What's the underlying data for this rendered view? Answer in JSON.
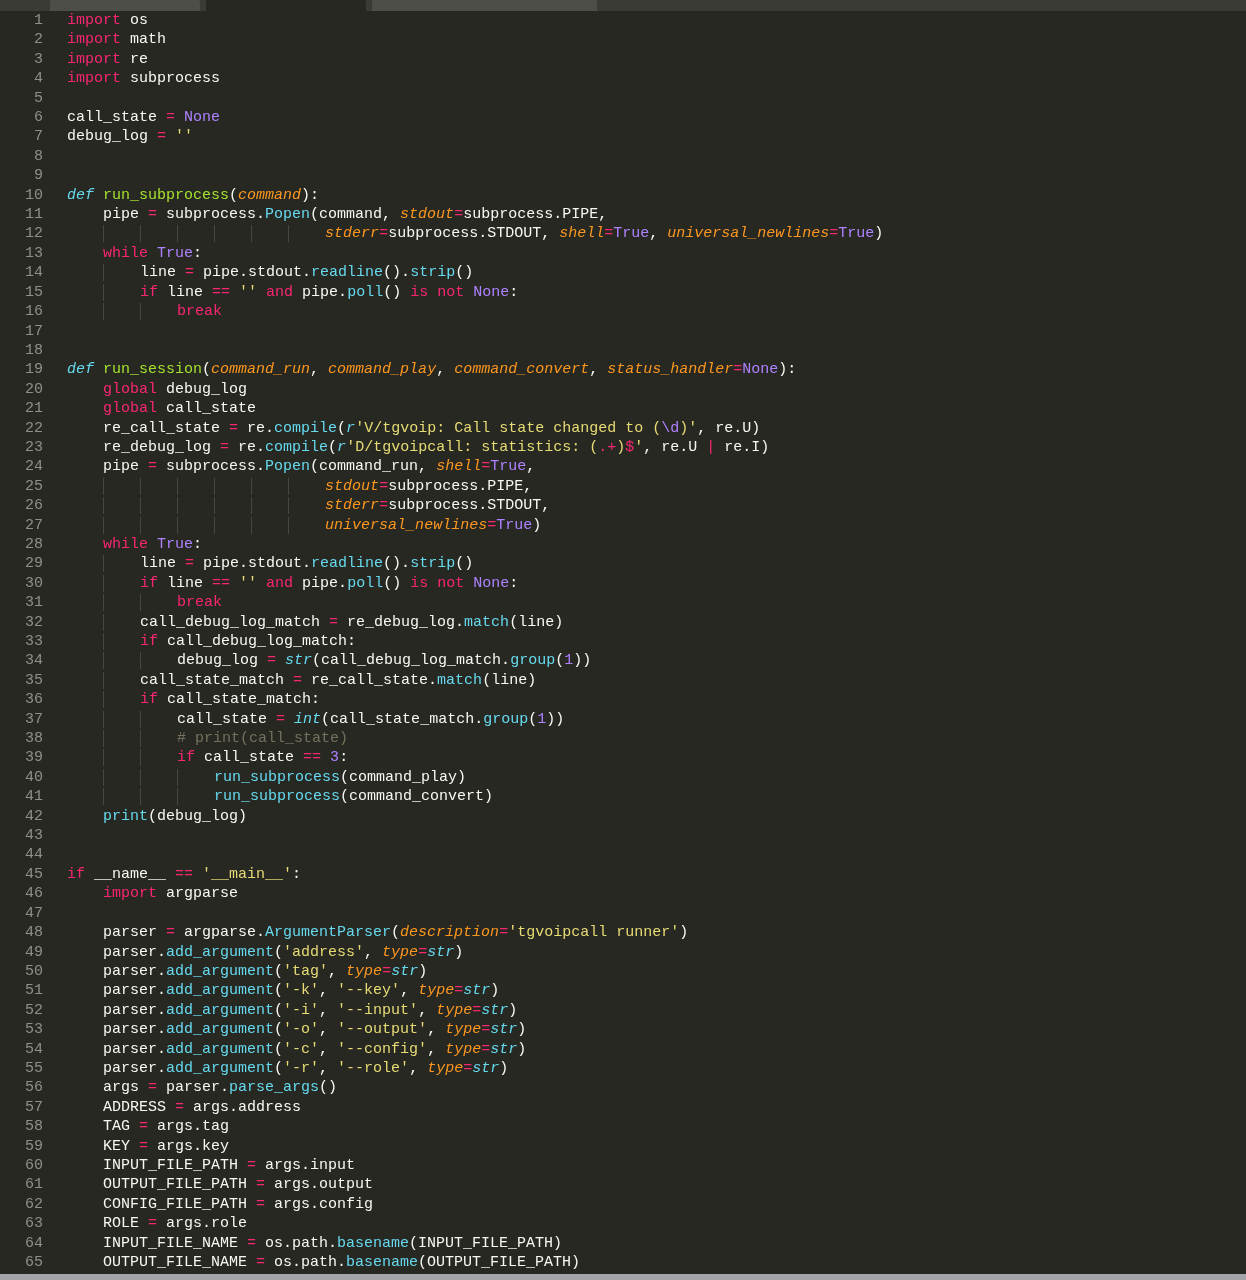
{
  "tabs": [
    {
      "selected": false
    },
    {
      "selected": true
    },
    {
      "selected": false
    }
  ],
  "lines": [
    {
      "number": "1",
      "tokens": [
        {
          "kind": "k",
          "text": "import"
        },
        {
          "kind": "p",
          "text": " os"
        }
      ]
    },
    {
      "number": "2",
      "tokens": [
        {
          "kind": "k",
          "text": "import"
        },
        {
          "kind": "p",
          "text": " math"
        }
      ]
    },
    {
      "number": "3",
      "tokens": [
        {
          "kind": "k",
          "text": "import"
        },
        {
          "kind": "p",
          "text": " re"
        }
      ]
    },
    {
      "number": "4",
      "tokens": [
        {
          "kind": "k",
          "text": "import"
        },
        {
          "kind": "p",
          "text": " subprocess"
        }
      ]
    },
    {
      "number": "5"
    },
    {
      "number": "6",
      "tokens": [
        {
          "kind": "p",
          "text": "call_state "
        },
        {
          "kind": "k",
          "text": "="
        },
        {
          "kind": "c",
          "text": " None"
        }
      ]
    },
    {
      "number": "7",
      "tokens": [
        {
          "kind": "p",
          "text": "debug_log "
        },
        {
          "kind": "k",
          "text": "="
        },
        {
          "kind": "s",
          "text": " ''"
        }
      ]
    },
    {
      "number": "8"
    },
    {
      "number": "9"
    },
    {
      "number": "10",
      "tokens": [
        {
          "kind": "d",
          "text": "def"
        },
        {
          "kind": "f",
          "text": " run_subprocess"
        },
        {
          "kind": "p",
          "text": "("
        },
        {
          "kind": "a",
          "text": "command"
        },
        {
          "kind": "p",
          "text": "):"
        }
      ]
    },
    {
      "number": "11",
      "tokens": [
        {
          "kind": "p",
          "text": "    pipe "
        },
        {
          "kind": "k",
          "text": "="
        },
        {
          "kind": "p",
          "text": " subprocess."
        },
        {
          "kind": "m",
          "text": "Popen"
        },
        {
          "kind": "p",
          "text": "(command, "
        },
        {
          "kind": "a",
          "text": "stdout"
        },
        {
          "kind": "k",
          "text": "="
        },
        {
          "kind": "p",
          "text": "subprocess.PIPE,"
        }
      ]
    },
    {
      "number": "12",
      "tokens": [
        {
          "kind": "a",
          "text": "                            stderr"
        },
        {
          "kind": "k",
          "text": "="
        },
        {
          "kind": "p",
          "text": "subprocess.STDOUT, "
        },
        {
          "kind": "a",
          "text": "shell"
        },
        {
          "kind": "k",
          "text": "="
        },
        {
          "kind": "c",
          "text": "True"
        },
        {
          "kind": "p",
          "text": ", "
        },
        {
          "kind": "a",
          "text": "universal_newlines"
        },
        {
          "kind": "k",
          "text": "="
        },
        {
          "kind": "c",
          "text": "True"
        },
        {
          "kind": "p",
          "text": ")"
        }
      ]
    },
    {
      "number": "13",
      "tokens": [
        {
          "kind": "k",
          "text": "    while"
        },
        {
          "kind": "c",
          "text": " True"
        },
        {
          "kind": "p",
          "text": ":"
        }
      ]
    },
    {
      "number": "14",
      "tokens": [
        {
          "kind": "p",
          "text": "        line "
        },
        {
          "kind": "k",
          "text": "="
        },
        {
          "kind": "p",
          "text": " pipe.stdout."
        },
        {
          "kind": "m",
          "text": "readline"
        },
        {
          "kind": "p",
          "text": "()."
        },
        {
          "kind": "m",
          "text": "strip"
        },
        {
          "kind": "p",
          "text": "()"
        }
      ]
    },
    {
      "number": "15",
      "tokens": [
        {
          "kind": "k",
          "text": "        if"
        },
        {
          "kind": "p",
          "text": " line "
        },
        {
          "kind": "k",
          "text": "=="
        },
        {
          "kind": "s",
          "text": " ''"
        },
        {
          "kind": "k",
          "text": " and"
        },
        {
          "kind": "p",
          "text": " pipe."
        },
        {
          "kind": "m",
          "text": "poll"
        },
        {
          "kind": "p",
          "text": "() "
        },
        {
          "kind": "k",
          "text": "is"
        },
        {
          "kind": "k",
          "text": " not"
        },
        {
          "kind": "c",
          "text": " None"
        },
        {
          "kind": "p",
          "text": ":"
        }
      ]
    },
    {
      "number": "16",
      "tokens": [
        {
          "kind": "k",
          "text": "            break"
        }
      ]
    },
    {
      "number": "17"
    },
    {
      "number": "18"
    },
    {
      "number": "19",
      "tokens": [
        {
          "kind": "d",
          "text": "def"
        },
        {
          "kind": "f",
          "text": " run_session"
        },
        {
          "kind": "p",
          "text": "("
        },
        {
          "kind": "a",
          "text": "command_run"
        },
        {
          "kind": "p",
          "text": ", "
        },
        {
          "kind": "a",
          "text": "command_play"
        },
        {
          "kind": "p",
          "text": ", "
        },
        {
          "kind": "a",
          "text": "command_convert"
        },
        {
          "kind": "p",
          "text": ", "
        },
        {
          "kind": "a",
          "text": "status_handler"
        },
        {
          "kind": "k",
          "text": "="
        },
        {
          "kind": "c",
          "text": "None"
        },
        {
          "kind": "p",
          "text": "):"
        }
      ]
    },
    {
      "number": "20",
      "tokens": [
        {
          "kind": "k",
          "text": "    global"
        },
        {
          "kind": "p",
          "text": " debug_log"
        }
      ]
    },
    {
      "number": "21",
      "tokens": [
        {
          "kind": "k",
          "text": "    global"
        },
        {
          "kind": "p",
          "text": " call_state"
        }
      ]
    },
    {
      "number": "22",
      "tokens": [
        {
          "kind": "p",
          "text": "    re_call_state "
        },
        {
          "kind": "k",
          "text": "="
        },
        {
          "kind": "p",
          "text": " re."
        },
        {
          "kind": "m",
          "text": "compile"
        },
        {
          "kind": "p",
          "text": "("
        },
        {
          "kind": "b",
          "text": "r"
        },
        {
          "kind": "s",
          "text": "'V/tgvoip: Call state changed to ("
        },
        {
          "kind": "c",
          "text": "\\d"
        },
        {
          "kind": "s",
          "text": ")'"
        },
        {
          "kind": "p",
          "text": ", re.U)"
        }
      ]
    },
    {
      "number": "23",
      "tokens": [
        {
          "kind": "p",
          "text": "    re_debug_log "
        },
        {
          "kind": "k",
          "text": "="
        },
        {
          "kind": "p",
          "text": " re."
        },
        {
          "kind": "m",
          "text": "compile"
        },
        {
          "kind": "p",
          "text": "("
        },
        {
          "kind": "b",
          "text": "r"
        },
        {
          "kind": "s",
          "text": "'D/tgvoipcall: statistics: ("
        },
        {
          "kind": "k",
          "text": ".+"
        },
        {
          "kind": "s",
          "text": ")"
        },
        {
          "kind": "k",
          "text": "$"
        },
        {
          "kind": "s",
          "text": "'"
        },
        {
          "kind": "p",
          "text": ", re.U "
        },
        {
          "kind": "k",
          "text": "|"
        },
        {
          "kind": "p",
          "text": " re.I)"
        }
      ]
    },
    {
      "number": "24",
      "tokens": [
        {
          "kind": "p",
          "text": "    pipe "
        },
        {
          "kind": "k",
          "text": "="
        },
        {
          "kind": "p",
          "text": " subprocess."
        },
        {
          "kind": "m",
          "text": "Popen"
        },
        {
          "kind": "p",
          "text": "(command_run, "
        },
        {
          "kind": "a",
          "text": "shell"
        },
        {
          "kind": "k",
          "text": "="
        },
        {
          "kind": "c",
          "text": "True"
        },
        {
          "kind": "p",
          "text": ","
        }
      ]
    },
    {
      "number": "25",
      "tokens": [
        {
          "kind": "a",
          "text": "                            stdout"
        },
        {
          "kind": "k",
          "text": "="
        },
        {
          "kind": "p",
          "text": "subprocess.PIPE,"
        }
      ]
    },
    {
      "number": "26",
      "tokens": [
        {
          "kind": "a",
          "text": "                            stderr"
        },
        {
          "kind": "k",
          "text": "="
        },
        {
          "kind": "p",
          "text": "subprocess.STDOUT,"
        }
      ]
    },
    {
      "number": "27",
      "tokens": [
        {
          "kind": "a",
          "text": "                            universal_newlines"
        },
        {
          "kind": "k",
          "text": "="
        },
        {
          "kind": "c",
          "text": "True"
        },
        {
          "kind": "p",
          "text": ")"
        }
      ]
    },
    {
      "number": "28",
      "tokens": [
        {
          "kind": "k",
          "text": "    while"
        },
        {
          "kind": "c",
          "text": " True"
        },
        {
          "kind": "p",
          "text": ":"
        }
      ]
    },
    {
      "number": "29",
      "tokens": [
        {
          "kind": "p",
          "text": "        line "
        },
        {
          "kind": "k",
          "text": "="
        },
        {
          "kind": "p",
          "text": " pipe.stdout."
        },
        {
          "kind": "m",
          "text": "readline"
        },
        {
          "kind": "p",
          "text": "()."
        },
        {
          "kind": "m",
          "text": "strip"
        },
        {
          "kind": "p",
          "text": "()"
        }
      ]
    },
    {
      "number": "30",
      "tokens": [
        {
          "kind": "k",
          "text": "        if"
        },
        {
          "kind": "p",
          "text": " line "
        },
        {
          "kind": "k",
          "text": "=="
        },
        {
          "kind": "s",
          "text": " ''"
        },
        {
          "kind": "k",
          "text": " and"
        },
        {
          "kind": "p",
          "text": " pipe."
        },
        {
          "kind": "m",
          "text": "poll"
        },
        {
          "kind": "p",
          "text": "() "
        },
        {
          "kind": "k",
          "text": "is"
        },
        {
          "kind": "k",
          "text": " not"
        },
        {
          "kind": "c",
          "text": " None"
        },
        {
          "kind": "p",
          "text": ":"
        }
      ]
    },
    {
      "number": "31",
      "tokens": [
        {
          "kind": "k",
          "text": "            break"
        }
      ]
    },
    {
      "number": "32",
      "tokens": [
        {
          "kind": "p",
          "text": "        call_debug_log_match "
        },
        {
          "kind": "k",
          "text": "="
        },
        {
          "kind": "p",
          "text": " re_debug_log."
        },
        {
          "kind": "m",
          "text": "match"
        },
        {
          "kind": "p",
          "text": "(line)"
        }
      ]
    },
    {
      "number": "33",
      "tokens": [
        {
          "kind": "k",
          "text": "        if"
        },
        {
          "kind": "p",
          "text": " call_debug_log_match:"
        }
      ]
    },
    {
      "number": "34",
      "tokens": [
        {
          "kind": "p",
          "text": "            debug_log "
        },
        {
          "kind": "k",
          "text": "="
        },
        {
          "kind": "b",
          "text": " str"
        },
        {
          "kind": "p",
          "text": "(call_debug_log_match."
        },
        {
          "kind": "m",
          "text": "group"
        },
        {
          "kind": "p",
          "text": "("
        },
        {
          "kind": "c",
          "text": "1"
        },
        {
          "kind": "p",
          "text": "))"
        }
      ]
    },
    {
      "number": "35",
      "tokens": [
        {
          "kind": "p",
          "text": "        call_state_match "
        },
        {
          "kind": "k",
          "text": "="
        },
        {
          "kind": "p",
          "text": " re_call_state."
        },
        {
          "kind": "m",
          "text": "match"
        },
        {
          "kind": "p",
          "text": "(line)"
        }
      ]
    },
    {
      "number": "36",
      "tokens": [
        {
          "kind": "k",
          "text": "        if"
        },
        {
          "kind": "p",
          "text": " call_state_match:"
        }
      ]
    },
    {
      "number": "37",
      "tokens": [
        {
          "kind": "p",
          "text": "            call_state "
        },
        {
          "kind": "k",
          "text": "="
        },
        {
          "kind": "b",
          "text": " int"
        },
        {
          "kind": "p",
          "text": "(call_state_match."
        },
        {
          "kind": "m",
          "text": "group"
        },
        {
          "kind": "p",
          "text": "("
        },
        {
          "kind": "c",
          "text": "1"
        },
        {
          "kind": "p",
          "text": "))"
        }
      ]
    },
    {
      "number": "38",
      "tokens": [
        {
          "kind": "o",
          "text": "            # print(call_state)"
        }
      ]
    },
    {
      "number": "39",
      "tokens": [
        {
          "kind": "k",
          "text": "            if"
        },
        {
          "kind": "p",
          "text": " call_state "
        },
        {
          "kind": "k",
          "text": "=="
        },
        {
          "kind": "c",
          "text": " 3"
        },
        {
          "kind": "p",
          "text": ":"
        }
      ]
    },
    {
      "number": "40",
      "tokens": [
        {
          "kind": "m",
          "text": "                run_subprocess"
        },
        {
          "kind": "p",
          "text": "(command_play)"
        }
      ]
    },
    {
      "number": "41",
      "tokens": [
        {
          "kind": "m",
          "text": "                run_subprocess"
        },
        {
          "kind": "p",
          "text": "(command_convert)"
        }
      ]
    },
    {
      "number": "42",
      "tokens": [
        {
          "kind": "m",
          "text": "    print"
        },
        {
          "kind": "p",
          "text": "(debug_log)"
        }
      ]
    },
    {
      "number": "43"
    },
    {
      "number": "44"
    },
    {
      "number": "45",
      "tokens": [
        {
          "kind": "k",
          "text": "if"
        },
        {
          "kind": "p",
          "text": " __name__ "
        },
        {
          "kind": "k",
          "text": "=="
        },
        {
          "kind": "s",
          "text": " '__main__'"
        },
        {
          "kind": "p",
          "text": ":"
        }
      ]
    },
    {
      "number": "46",
      "tokens": [
        {
          "kind": "k",
          "text": "    import"
        },
        {
          "kind": "p",
          "text": " argparse"
        }
      ]
    },
    {
      "number": "47"
    },
    {
      "number": "48",
      "tokens": [
        {
          "kind": "p",
          "text": "    parser "
        },
        {
          "kind": "k",
          "text": "="
        },
        {
          "kind": "p",
          "text": " argparse."
        },
        {
          "kind": "m",
          "text": "ArgumentParser"
        },
        {
          "kind": "p",
          "text": "("
        },
        {
          "kind": "a",
          "text": "description"
        },
        {
          "kind": "k",
          "text": "="
        },
        {
          "kind": "s",
          "text": "'tgvoipcall runner'"
        },
        {
          "kind": "p",
          "text": ")"
        }
      ]
    },
    {
      "number": "49",
      "tokens": [
        {
          "kind": "p",
          "text": "    parser."
        },
        {
          "kind": "m",
          "text": "add_argument"
        },
        {
          "kind": "p",
          "text": "("
        },
        {
          "kind": "s",
          "text": "'address'"
        },
        {
          "kind": "p",
          "text": ", "
        },
        {
          "kind": "a",
          "text": "type"
        },
        {
          "kind": "k",
          "text": "="
        },
        {
          "kind": "b",
          "text": "str"
        },
        {
          "kind": "p",
          "text": ")"
        }
      ]
    },
    {
      "number": "50",
      "tokens": [
        {
          "kind": "p",
          "text": "    parser."
        },
        {
          "kind": "m",
          "text": "add_argument"
        },
        {
          "kind": "p",
          "text": "("
        },
        {
          "kind": "s",
          "text": "'tag'"
        },
        {
          "kind": "p",
          "text": ", "
        },
        {
          "kind": "a",
          "text": "type"
        },
        {
          "kind": "k",
          "text": "="
        },
        {
          "kind": "b",
          "text": "str"
        },
        {
          "kind": "p",
          "text": ")"
        }
      ]
    },
    {
      "number": "51",
      "tokens": [
        {
          "kind": "p",
          "text": "    parser."
        },
        {
          "kind": "m",
          "text": "add_argument"
        },
        {
          "kind": "p",
          "text": "("
        },
        {
          "kind": "s",
          "text": "'-k'"
        },
        {
          "kind": "p",
          "text": ", "
        },
        {
          "kind": "s",
          "text": "'--key'"
        },
        {
          "kind": "p",
          "text": ", "
        },
        {
          "kind": "a",
          "text": "type"
        },
        {
          "kind": "k",
          "text": "="
        },
        {
          "kind": "b",
          "text": "str"
        },
        {
          "kind": "p",
          "text": ")"
        }
      ]
    },
    {
      "number": "52",
      "tokens": [
        {
          "kind": "p",
          "text": "    parser."
        },
        {
          "kind": "m",
          "text": "add_argument"
        },
        {
          "kind": "p",
          "text": "("
        },
        {
          "kind": "s",
          "text": "'-i'"
        },
        {
          "kind": "p",
          "text": ", "
        },
        {
          "kind": "s",
          "text": "'--input'"
        },
        {
          "kind": "p",
          "text": ", "
        },
        {
          "kind": "a",
          "text": "type"
        },
        {
          "kind": "k",
          "text": "="
        },
        {
          "kind": "b",
          "text": "str"
        },
        {
          "kind": "p",
          "text": ")"
        }
      ]
    },
    {
      "number": "53",
      "tokens": [
        {
          "kind": "p",
          "text": "    parser."
        },
        {
          "kind": "m",
          "text": "add_argument"
        },
        {
          "kind": "p",
          "text": "("
        },
        {
          "kind": "s",
          "text": "'-o'"
        },
        {
          "kind": "p",
          "text": ", "
        },
        {
          "kind": "s",
          "text": "'--output'"
        },
        {
          "kind": "p",
          "text": ", "
        },
        {
          "kind": "a",
          "text": "type"
        },
        {
          "kind": "k",
          "text": "="
        },
        {
          "kind": "b",
          "text": "str"
        },
        {
          "kind": "p",
          "text": ")"
        }
      ]
    },
    {
      "number": "54",
      "tokens": [
        {
          "kind": "p",
          "text": "    parser."
        },
        {
          "kind": "m",
          "text": "add_argument"
        },
        {
          "kind": "p",
          "text": "("
        },
        {
          "kind": "s",
          "text": "'-c'"
        },
        {
          "kind": "p",
          "text": ", "
        },
        {
          "kind": "s",
          "text": "'--config'"
        },
        {
          "kind": "p",
          "text": ", "
        },
        {
          "kind": "a",
          "text": "type"
        },
        {
          "kind": "k",
          "text": "="
        },
        {
          "kind": "b",
          "text": "str"
        },
        {
          "kind": "p",
          "text": ")"
        }
      ]
    },
    {
      "number": "55",
      "tokens": [
        {
          "kind": "p",
          "text": "    parser."
        },
        {
          "kind": "m",
          "text": "add_argument"
        },
        {
          "kind": "p",
          "text": "("
        },
        {
          "kind": "s",
          "text": "'-r'"
        },
        {
          "kind": "p",
          "text": ", "
        },
        {
          "kind": "s",
          "text": "'--role'"
        },
        {
          "kind": "p",
          "text": ", "
        },
        {
          "kind": "a",
          "text": "type"
        },
        {
          "kind": "k",
          "text": "="
        },
        {
          "kind": "b",
          "text": "str"
        },
        {
          "kind": "p",
          "text": ")"
        }
      ]
    },
    {
      "number": "56",
      "tokens": [
        {
          "kind": "p",
          "text": "    args "
        },
        {
          "kind": "k",
          "text": "="
        },
        {
          "kind": "p",
          "text": " parser."
        },
        {
          "kind": "m",
          "text": "parse_args"
        },
        {
          "kind": "p",
          "text": "()"
        }
      ]
    },
    {
      "number": "57",
      "tokens": [
        {
          "kind": "p",
          "text": "    ADDRESS "
        },
        {
          "kind": "k",
          "text": "="
        },
        {
          "kind": "p",
          "text": " args.address"
        }
      ]
    },
    {
      "number": "58",
      "tokens": [
        {
          "kind": "p",
          "text": "    TAG "
        },
        {
          "kind": "k",
          "text": "="
        },
        {
          "kind": "p",
          "text": " args.tag"
        }
      ]
    },
    {
      "number": "59",
      "tokens": [
        {
          "kind": "p",
          "text": "    KEY "
        },
        {
          "kind": "k",
          "text": "="
        },
        {
          "kind": "p",
          "text": " args.key"
        }
      ]
    },
    {
      "number": "60",
      "tokens": [
        {
          "kind": "p",
          "text": "    INPUT_FILE_PATH "
        },
        {
          "kind": "k",
          "text": "="
        },
        {
          "kind": "p",
          "text": " args.input"
        }
      ]
    },
    {
      "number": "61",
      "tokens": [
        {
          "kind": "p",
          "text": "    OUTPUT_FILE_PATH "
        },
        {
          "kind": "k",
          "text": "="
        },
        {
          "kind": "p",
          "text": " args.output"
        }
      ]
    },
    {
      "number": "62",
      "tokens": [
        {
          "kind": "p",
          "text": "    CONFIG_FILE_PATH "
        },
        {
          "kind": "k",
          "text": "="
        },
        {
          "kind": "p",
          "text": " args.config"
        }
      ]
    },
    {
      "number": "63",
      "tokens": [
        {
          "kind": "p",
          "text": "    ROLE "
        },
        {
          "kind": "k",
          "text": "="
        },
        {
          "kind": "p",
          "text": " args.role"
        }
      ]
    },
    {
      "number": "64",
      "tokens": [
        {
          "kind": "p",
          "text": "    INPUT_FILE_NAME "
        },
        {
          "kind": "k",
          "text": "="
        },
        {
          "kind": "p",
          "text": " os.path."
        },
        {
          "kind": "m",
          "text": "basename"
        },
        {
          "kind": "p",
          "text": "(INPUT_FILE_PATH)"
        }
      ]
    },
    {
      "number": "65",
      "tokens": [
        {
          "kind": "p",
          "text": "    OUTPUT_FILE_NAME "
        },
        {
          "kind": "k",
          "text": "="
        },
        {
          "kind": "p",
          "text": " os.path."
        },
        {
          "kind": "m",
          "text": "basename"
        },
        {
          "kind": "p",
          "text": "(OUTPUT_FILE_PATH)"
        }
      ]
    }
  ]
}
